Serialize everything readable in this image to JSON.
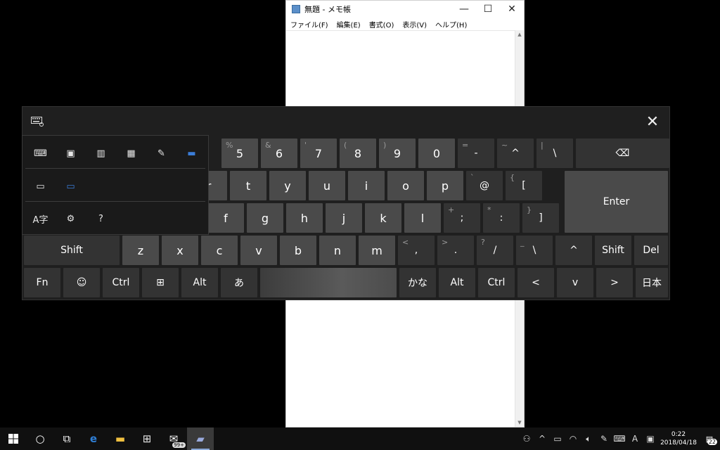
{
  "notepad": {
    "title": "無題 - メモ帳",
    "menu": [
      "ファイル(F)",
      "編集(E)",
      "書式(O)",
      "表示(V)",
      "ヘルプ(H)"
    ]
  },
  "keyboard": {
    "close_glyph": "✕",
    "row1": [
      {
        "label": "5",
        "sub": "%"
      },
      {
        "label": "6",
        "sub": "&"
      },
      {
        "label": "7",
        "sub": "'"
      },
      {
        "label": "8",
        "sub": "("
      },
      {
        "label": "9",
        "sub": ")"
      },
      {
        "label": "0",
        "sub": ""
      },
      {
        "label": "-",
        "sub": "="
      },
      {
        "label": "^",
        "sub": "~"
      },
      {
        "label": "\\",
        "sub": "|"
      },
      {
        "label": "⌫",
        "sub": ""
      }
    ],
    "row2": [
      {
        "label": "r",
        "sub": ""
      },
      {
        "label": "t",
        "sub": ""
      },
      {
        "label": "y",
        "sub": ""
      },
      {
        "label": "u",
        "sub": ""
      },
      {
        "label": "i",
        "sub": ""
      },
      {
        "label": "o",
        "sub": ""
      },
      {
        "label": "p",
        "sub": ""
      },
      {
        "label": "@",
        "sub": "`"
      },
      {
        "label": "[",
        "sub": "{"
      }
    ],
    "enter": "Enter",
    "row3": [
      {
        "label": "f",
        "sub": ""
      },
      {
        "label": "g",
        "sub": ""
      },
      {
        "label": "h",
        "sub": ""
      },
      {
        "label": "j",
        "sub": ""
      },
      {
        "label": "k",
        "sub": ""
      },
      {
        "label": "l",
        "sub": ""
      },
      {
        "label": ";",
        "sub": "+"
      },
      {
        "label": ":",
        "sub": "*"
      },
      {
        "label": "]",
        "sub": "}"
      }
    ],
    "row4": [
      {
        "label": "Shift",
        "sub": ""
      },
      {
        "label": "z",
        "sub": ""
      },
      {
        "label": "x",
        "sub": ""
      },
      {
        "label": "c",
        "sub": ""
      },
      {
        "label": "v",
        "sub": ""
      },
      {
        "label": "b",
        "sub": ""
      },
      {
        "label": "n",
        "sub": ""
      },
      {
        "label": "m",
        "sub": ""
      },
      {
        "label": ",",
        "sub": "<"
      },
      {
        "label": ".",
        "sub": ">"
      },
      {
        "label": "/",
        "sub": "?"
      },
      {
        "label": "\\",
        "sub": "_"
      },
      {
        "label": "^",
        "sub": ""
      },
      {
        "label": "Shift",
        "sub": ""
      },
      {
        "label": "Del",
        "sub": ""
      }
    ],
    "row5": [
      {
        "label": "Fn"
      },
      {
        "label": "☺"
      },
      {
        "label": "Ctrl"
      },
      {
        "label": "⊞"
      },
      {
        "label": "Alt"
      },
      {
        "label": "あ"
      },
      {
        "label": ""
      },
      {
        "label": "かな"
      },
      {
        "label": "Alt"
      },
      {
        "label": "Ctrl"
      },
      {
        "label": "<"
      },
      {
        "label": "v"
      },
      {
        "label": ">"
      },
      {
        "label": "日本"
      }
    ]
  },
  "layout_popup": {
    "row1": [
      "⌨",
      "▣",
      "▥",
      "▦",
      "✎",
      "▬"
    ],
    "row2": [
      "▭",
      "▭"
    ],
    "row3": [
      "A字",
      "⚙",
      "?"
    ]
  },
  "taskbar": {
    "clock_time": "0:22",
    "clock_date": "2018/04/18",
    "store_badge": "99+",
    "ime_mode": "A",
    "notification_count": "22"
  }
}
